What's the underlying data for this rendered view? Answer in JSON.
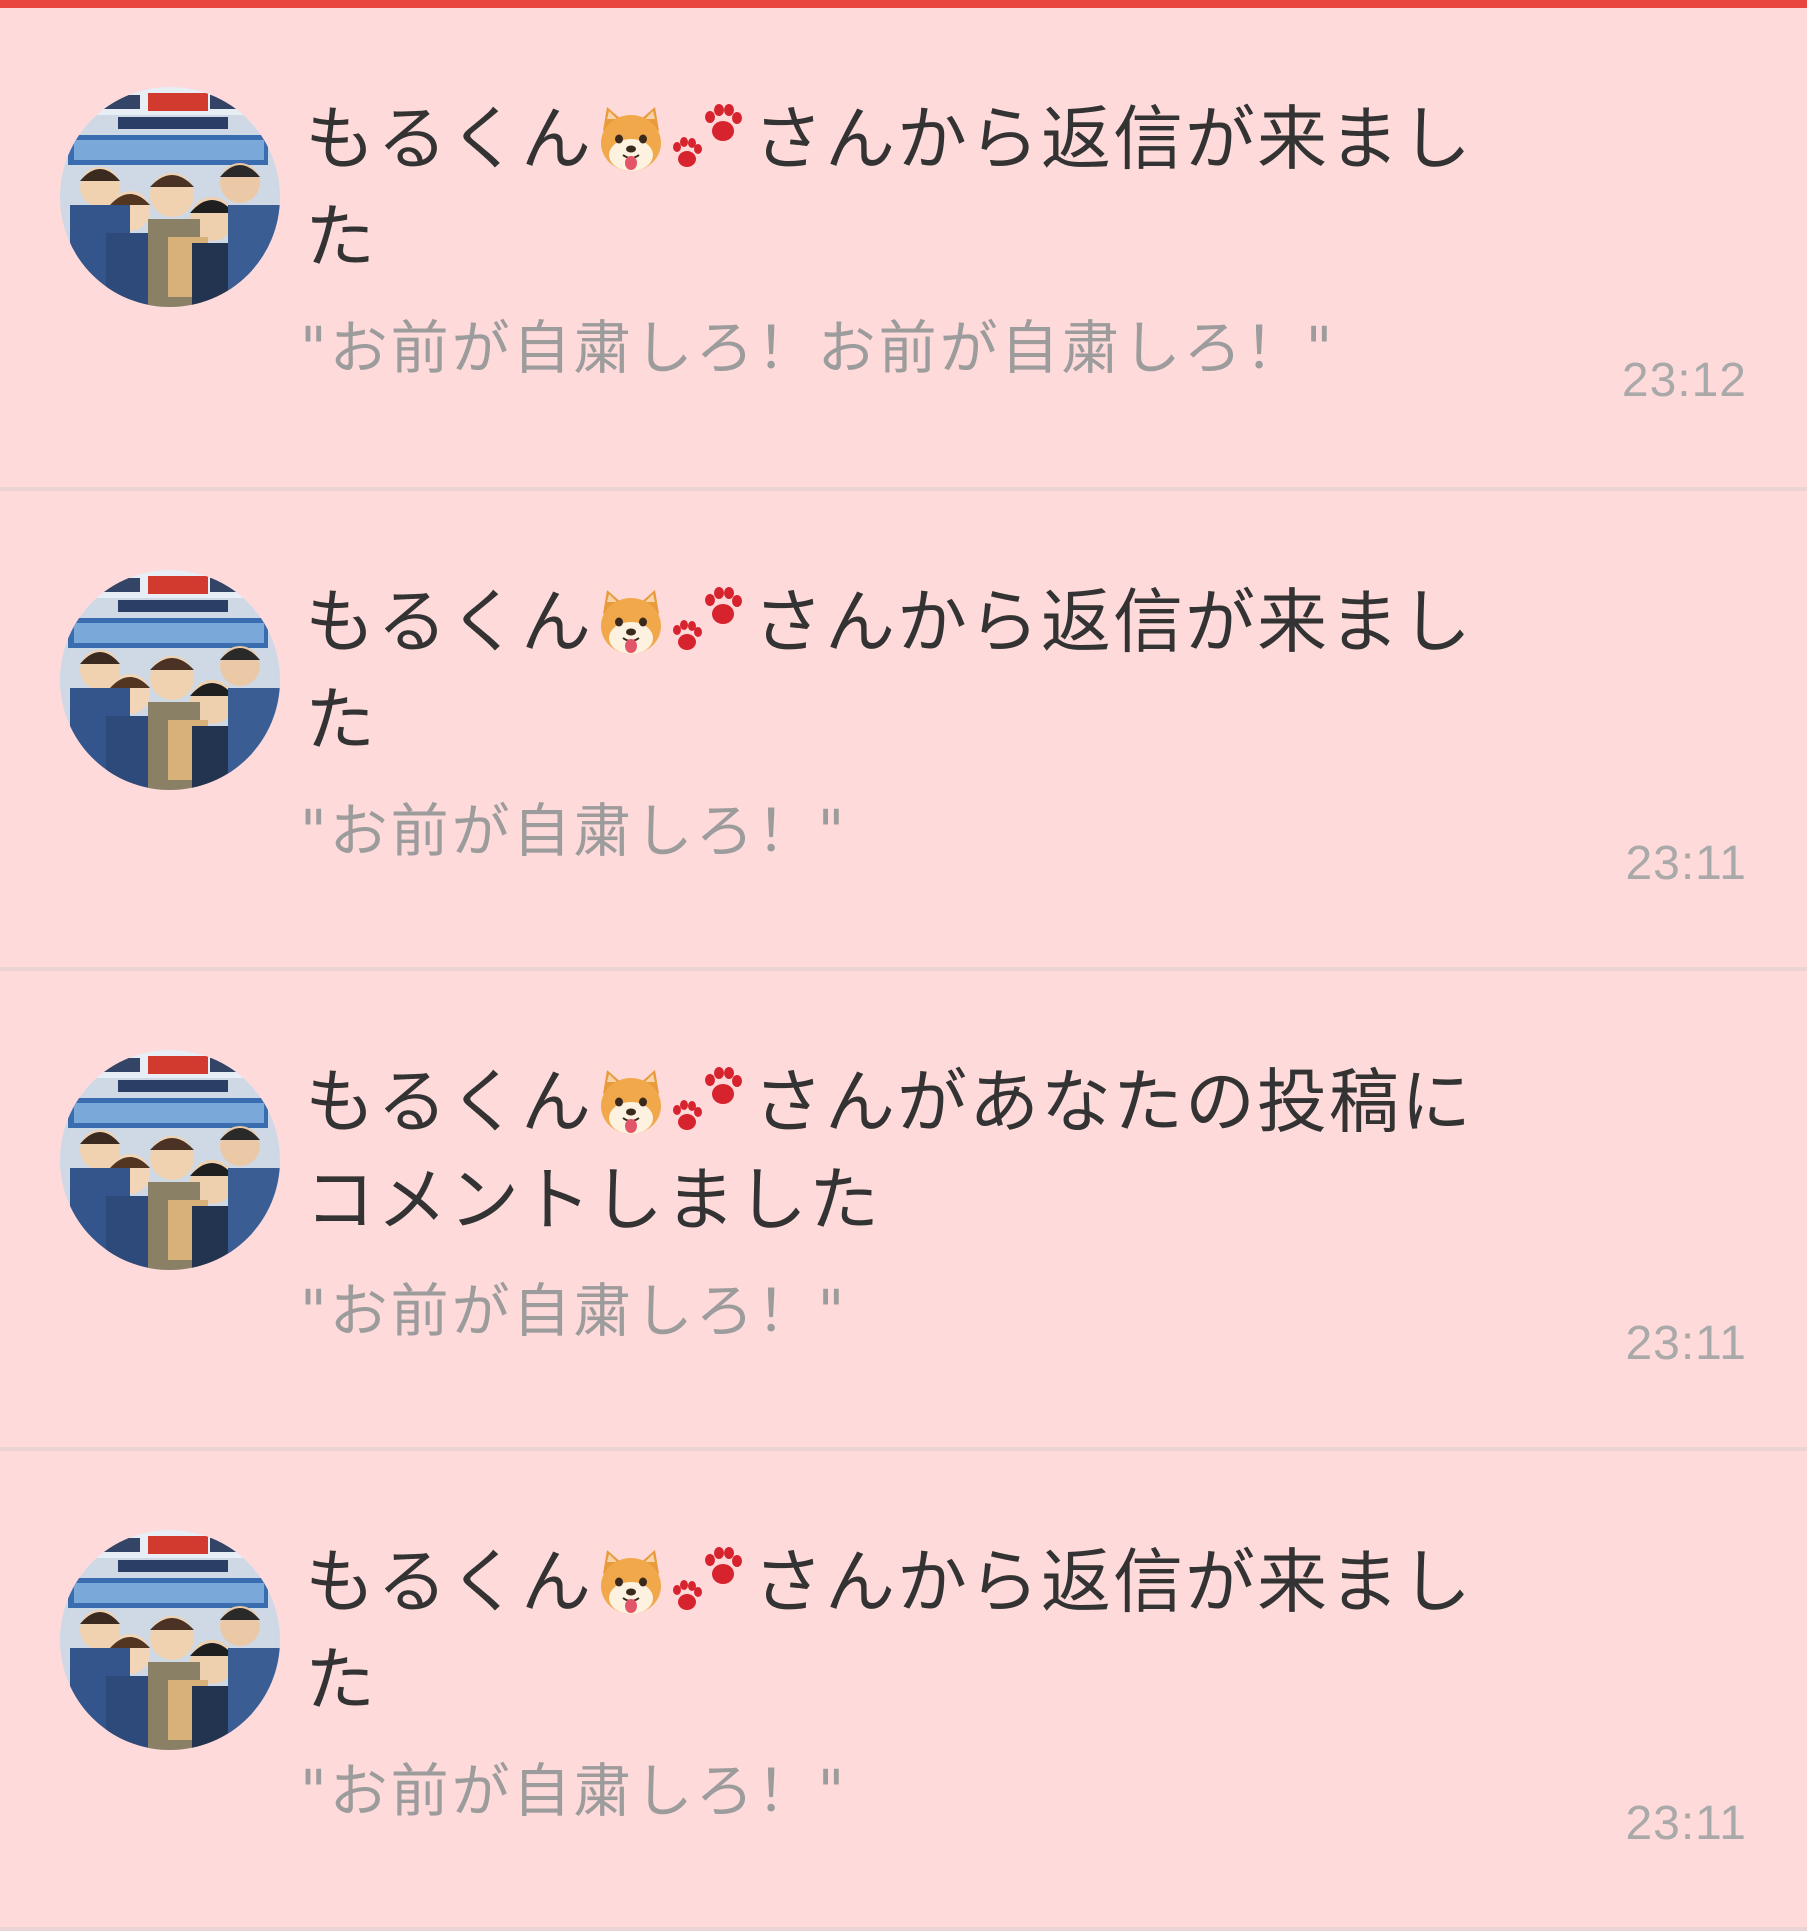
{
  "colors": {
    "accent": "#e8463f",
    "background": "#ffdadb",
    "divider": "#ecd3d4",
    "title_text": "#333333",
    "preview_text": "#9c9c9c",
    "time_text": "#a9a9a9"
  },
  "notifications": [
    {
      "user": "もるくん",
      "emoji": [
        "shiba-dog-face",
        "paw-prints"
      ],
      "action": "さんから返信が来ました",
      "preview": "\"お前が自粛しろ！お前が自粛しろ！\"",
      "time": "23:12",
      "avatar_icon": "anime-group-avatar"
    },
    {
      "user": "もるくん",
      "emoji": [
        "shiba-dog-face",
        "paw-prints"
      ],
      "action": "さんから返信が来ました",
      "preview": "\"お前が自粛しろ！\"",
      "time": "23:11",
      "avatar_icon": "anime-group-avatar"
    },
    {
      "user": "もるくん",
      "emoji": [
        "shiba-dog-face",
        "paw-prints"
      ],
      "action": "さんがあなたの投稿にコメントしました",
      "preview": "\"お前が自粛しろ！\"",
      "time": "23:11",
      "avatar_icon": "anime-group-avatar"
    },
    {
      "user": "もるくん",
      "emoji": [
        "shiba-dog-face",
        "paw-prints"
      ],
      "action": "さんから返信が来ました",
      "preview": "\"お前が自粛しろ！\"",
      "time": "23:11",
      "avatar_icon": "anime-group-avatar"
    }
  ]
}
